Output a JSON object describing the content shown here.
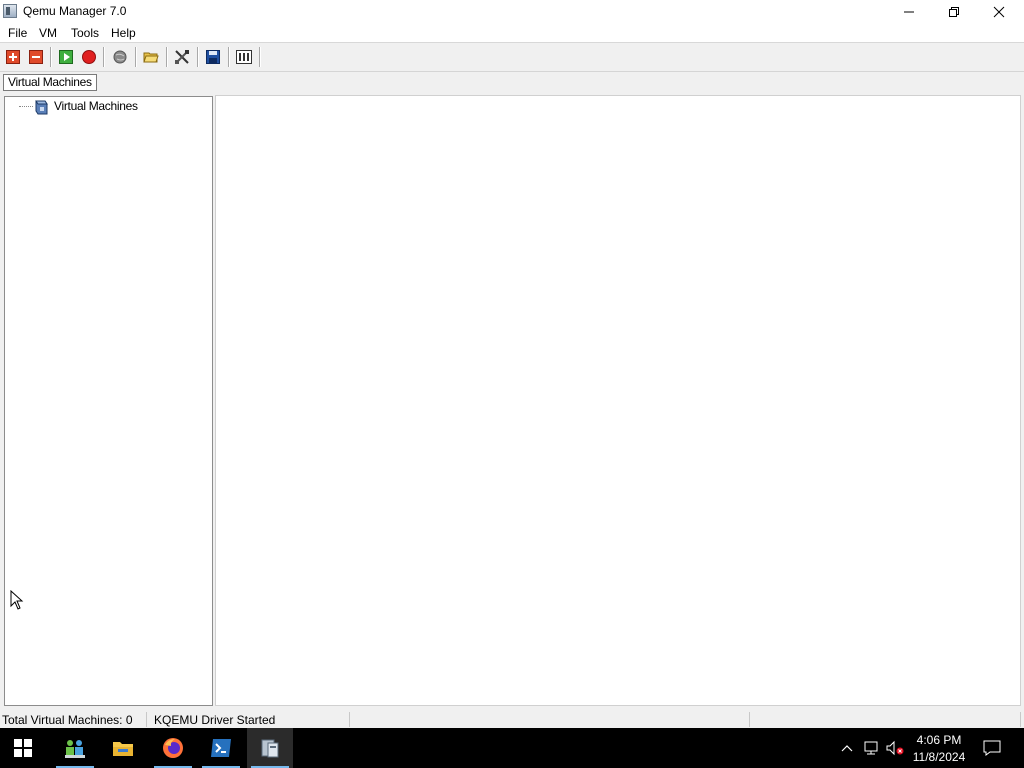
{
  "window": {
    "title": "Qemu Manager 7.0"
  },
  "menu": [
    "File",
    "VM",
    "Tools",
    "Help"
  ],
  "toolbar": {
    "buttons": [
      {
        "name": "add-vm-icon"
      },
      {
        "name": "remove-vm-icon"
      },
      {
        "name": "start-vm-icon"
      },
      {
        "name": "stop-vm-icon"
      },
      {
        "name": "network-icon"
      },
      {
        "name": "open-folder-icon"
      },
      {
        "name": "settings-tools-icon"
      },
      {
        "name": "save-icon"
      },
      {
        "name": "console-icon"
      }
    ]
  },
  "tabs": [
    "Virtual Machines"
  ],
  "tree": {
    "root_label": "Virtual Machines"
  },
  "statusbar": {
    "total_vms": "Total Virtual Machines: 0",
    "driver": "KQEMU Driver Started"
  },
  "taskbar": {
    "time": "4:06 PM",
    "date": "11/8/2024"
  },
  "colors": {
    "accent": "#76b9ed",
    "taskbar": "#000000",
    "window_bg": "#f0f0f0"
  }
}
